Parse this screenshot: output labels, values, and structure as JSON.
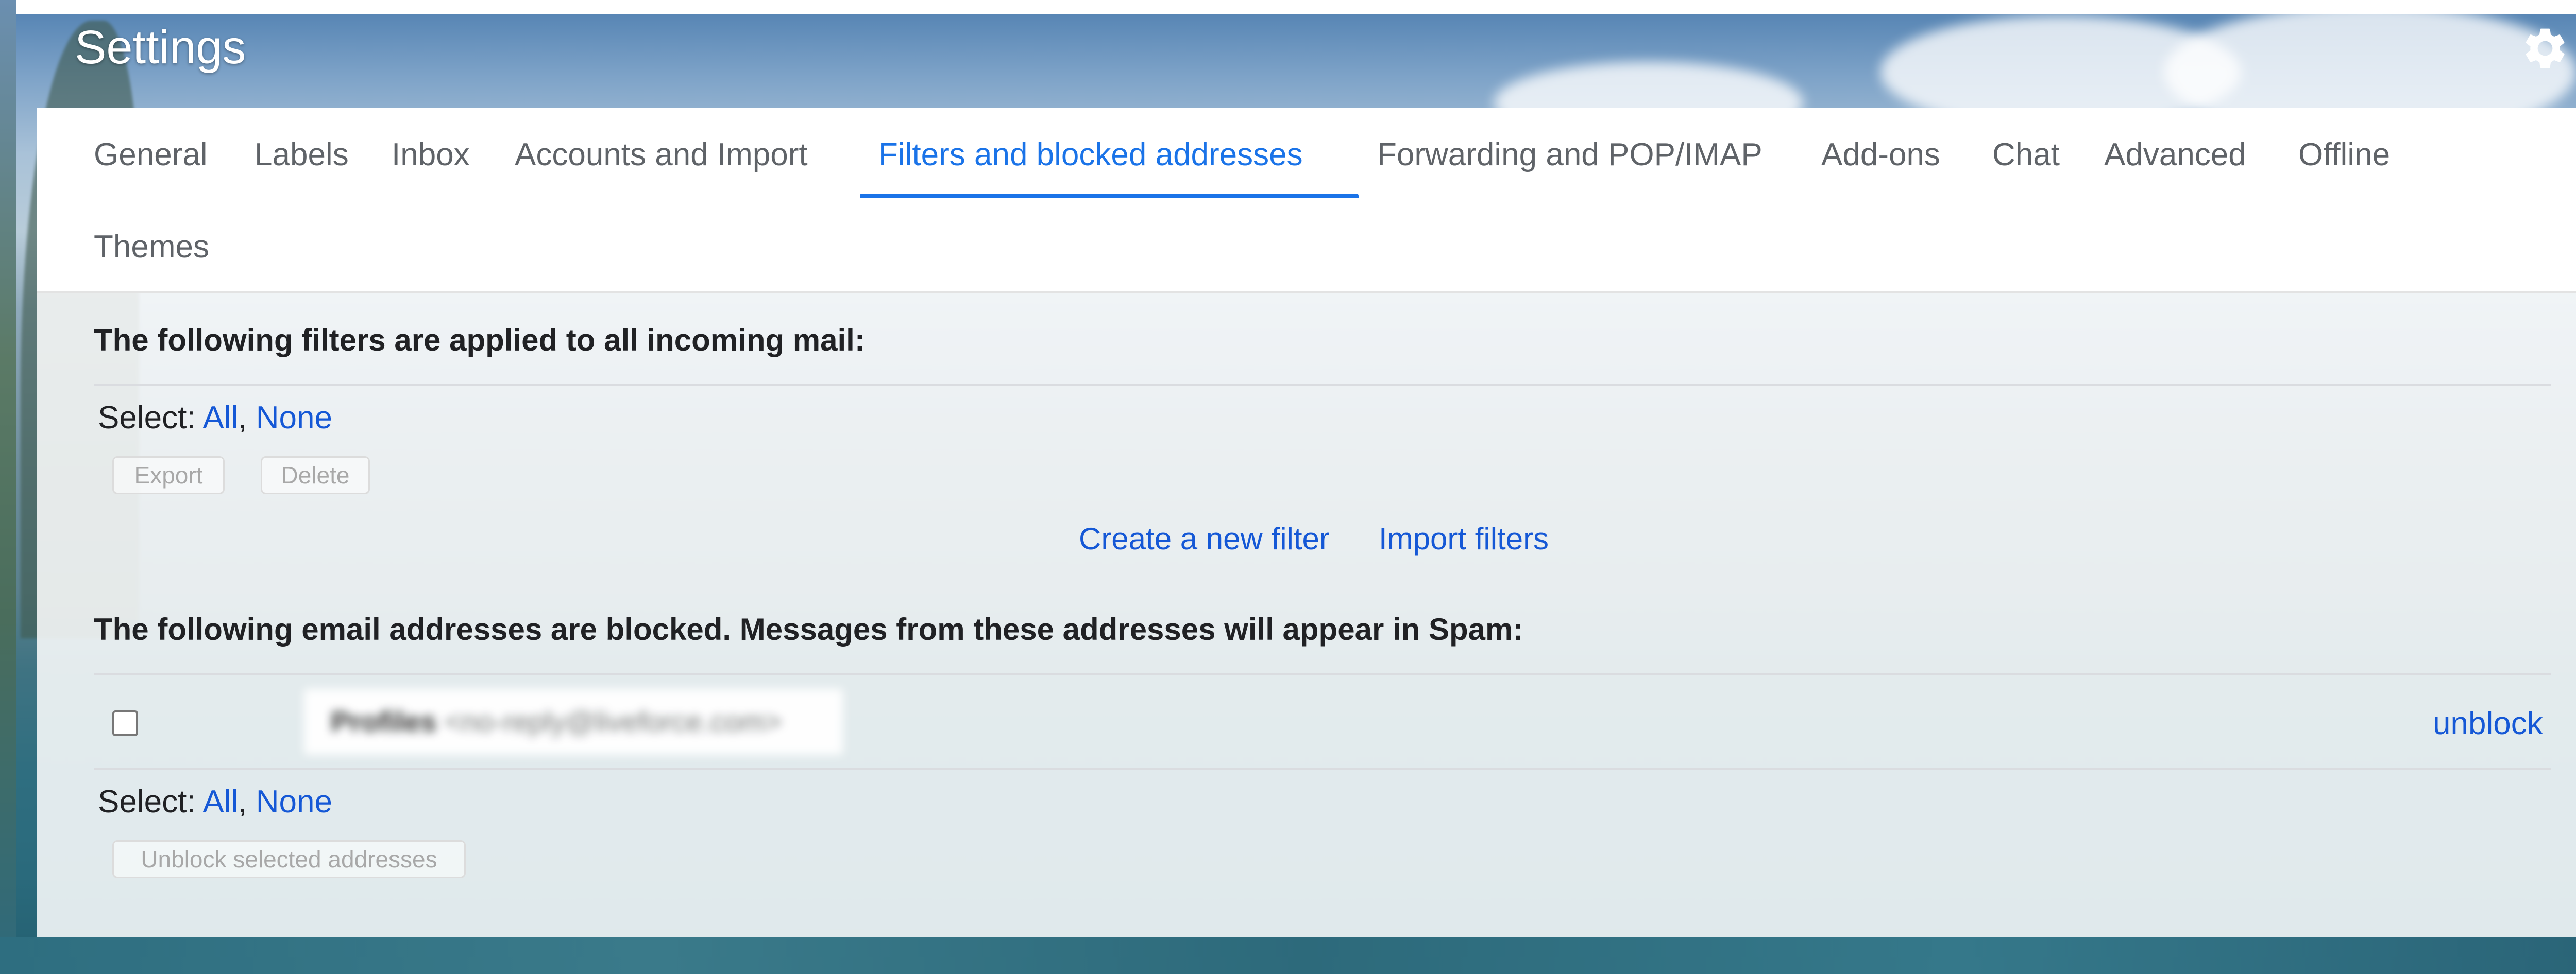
{
  "header": {
    "title": "Settings",
    "settings_icon": "gear-icon"
  },
  "tabs": [
    {
      "label": "General",
      "active": false
    },
    {
      "label": "Labels",
      "active": false
    },
    {
      "label": "Inbox",
      "active": false
    },
    {
      "label": "Accounts and Import",
      "active": false
    },
    {
      "label": "Filters and blocked addresses",
      "active": true
    },
    {
      "label": "Forwarding and POP/IMAP",
      "active": false
    },
    {
      "label": "Add-ons",
      "active": false
    },
    {
      "label": "Chat",
      "active": false
    },
    {
      "label": "Advanced",
      "active": false
    },
    {
      "label": "Offline",
      "active": false
    },
    {
      "label": "Themes",
      "active": false
    }
  ],
  "filters": {
    "heading": "The following filters are applied to all incoming mail:",
    "select_label": "Select:",
    "select_all": "All",
    "select_none": "None",
    "export_label": "Export",
    "delete_label": "Delete",
    "create_filter": "Create a new filter",
    "import_filters": "Import filters"
  },
  "blocked": {
    "heading": "The following email addresses are blocked. Messages from these addresses will appear in Spam:",
    "rows": [
      {
        "name": "Profiles",
        "email": "<no-reply@liveforce.com>",
        "action": "unblock"
      }
    ],
    "select_label": "Select:",
    "select_all": "All",
    "select_none": "None",
    "unblock_selected": "Unblock selected addresses"
  },
  "colors": {
    "accent": "#1a73e8",
    "link": "#1558d6",
    "tab_text": "#5f6368"
  }
}
